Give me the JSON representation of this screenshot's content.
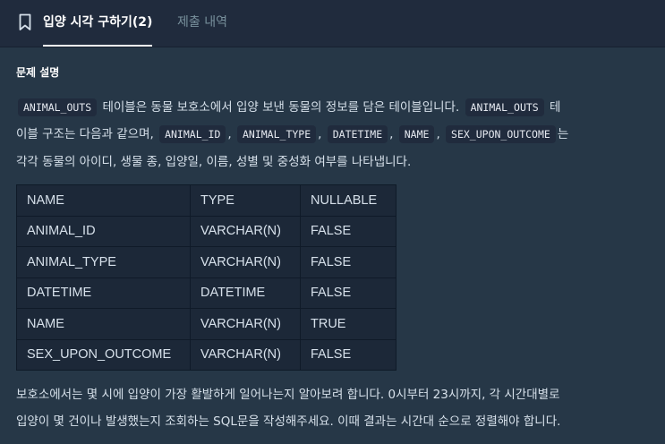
{
  "tabs": [
    {
      "label": "입양 시각 구하기(2)",
      "active": true
    },
    {
      "label": "제출 내역",
      "active": false
    }
  ],
  "description": {
    "title": "문제 설명",
    "paragraph1": {
      "line1": {
        "code1": "ANIMAL_OUTS",
        "text1": " 테이블은 동물 보호소에서 입양 보낸 동물의 정보를 담은 테이블입니다. ",
        "code2": "ANIMAL_OUTS",
        "text2": " 테"
      },
      "line2": {
        "text1": "이블 구조는 다음과 같으며, ",
        "code1": "ANIMAL_ID",
        "sep1": ",",
        "code2": "ANIMAL_TYPE",
        "sep2": ",",
        "code3": "DATETIME",
        "sep3": ",",
        "code4": "NAME",
        "sep4": ",",
        "code5": "SEX_UPON_OUTCOME",
        "text2": "는"
      },
      "line3": "각각 동물의 아이디, 생물 종, 입양일, 이름, 성별 및 중성화 여부를 나타냅니다."
    },
    "table": {
      "headers": [
        "NAME",
        "TYPE",
        "NULLABLE"
      ],
      "rows": [
        [
          "ANIMAL_ID",
          "VARCHAR(N)",
          "FALSE"
        ],
        [
          "ANIMAL_TYPE",
          "VARCHAR(N)",
          "FALSE"
        ],
        [
          "DATETIME",
          "DATETIME",
          "FALSE"
        ],
        [
          "NAME",
          "VARCHAR(N)",
          "TRUE"
        ],
        [
          "SEX_UPON_OUTCOME",
          "VARCHAR(N)",
          "FALSE"
        ]
      ]
    },
    "paragraph2": {
      "line1": "보호소에서는 몇 시에 입양이 가장 활발하게 일어나는지 알아보려 합니다. 0시부터 23시까지, 각 시간대별로",
      "line2": "입양이 몇 건이나 발생했는지 조회하는 SQL문을 작성해주세요. 이때 결과는 시간대 순으로 정렬해야 합니다."
    }
  },
  "colors": {
    "background": "#263747",
    "tabbar": "#202b3d",
    "code_bg": "#202b3d",
    "table_bg": "#1c2838"
  },
  "icons": {
    "tab_icon": "bookmark-icon"
  }
}
